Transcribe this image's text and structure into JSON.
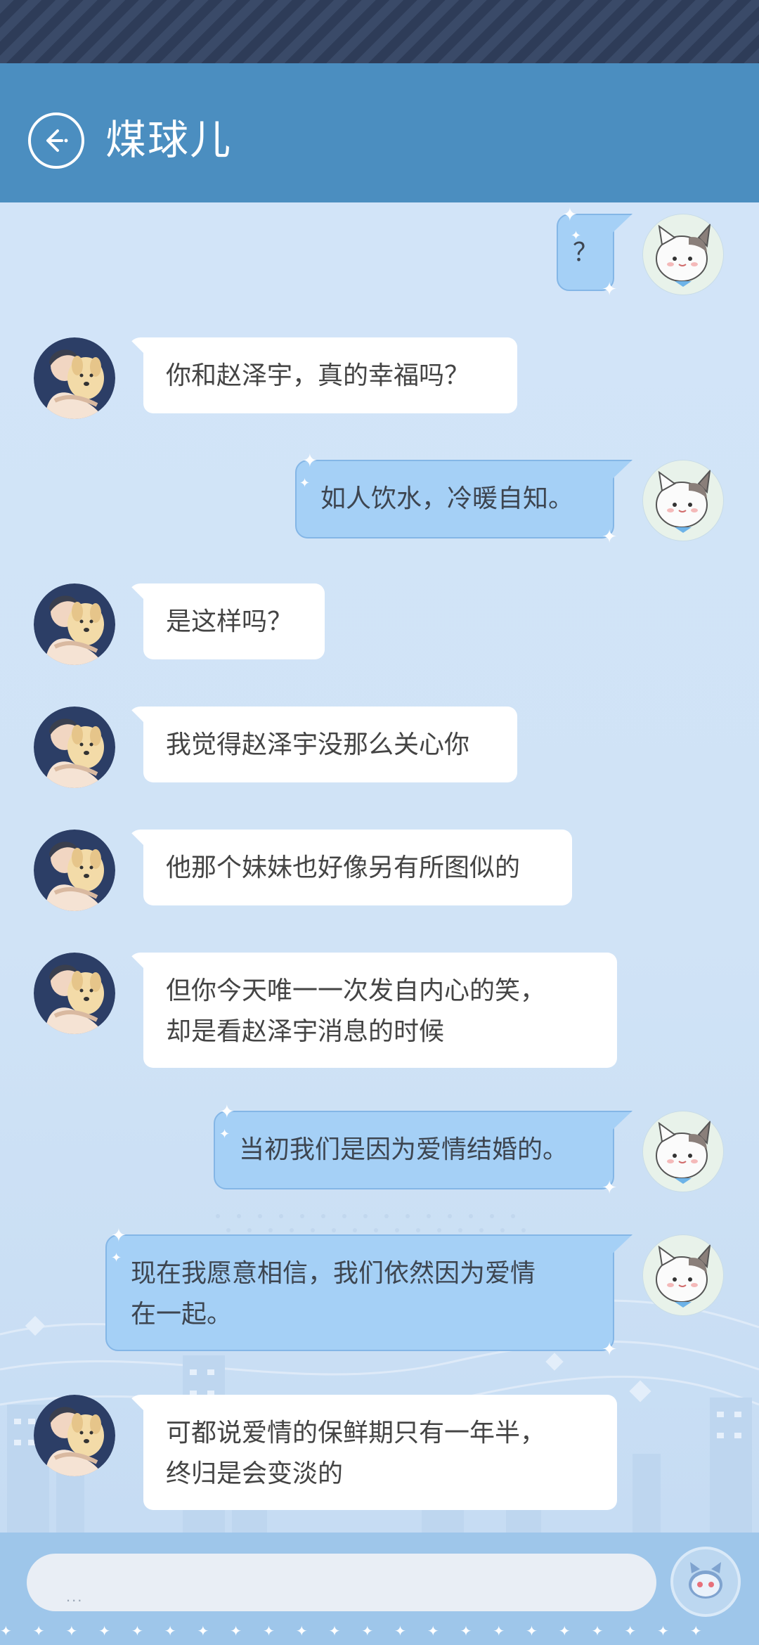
{
  "header": {
    "title": "煤球儿",
    "back_icon": "back-arrow-icon"
  },
  "messages": [
    {
      "side": "out",
      "lines": [
        "？"
      ]
    },
    {
      "side": "in",
      "lines": [
        "你和赵泽宇，真的幸福吗？"
      ]
    },
    {
      "side": "out",
      "lines": [
        "如人饮水，冷暖自知。"
      ]
    },
    {
      "side": "in",
      "lines": [
        "是这样吗？"
      ]
    },
    {
      "side": "in",
      "lines": [
        "我觉得赵泽宇没那么关心你"
      ]
    },
    {
      "side": "in",
      "lines": [
        "他那个妹妹也好像另有所图似的"
      ]
    },
    {
      "side": "in",
      "lines": [
        "但你今天唯一一次发自内心的笑，",
        "却是看赵泽宇消息的时候"
      ]
    },
    {
      "side": "out",
      "lines": [
        "当初我们是因为爱情结婚的。"
      ]
    },
    {
      "side": "out",
      "lines": [
        "现在我愿意相信，我们依然因为爱情",
        "在一起。"
      ]
    },
    {
      "side": "in",
      "lines": [
        "可都说爱情的保鲜期只有一年半，",
        "终归是会变淡的"
      ]
    }
  ],
  "input": {
    "placeholder": "..."
  },
  "colors": {
    "header": "#4b8ec0",
    "chat_bg": "#cfe2f6",
    "outgoing_bubble": "#a5d0f6",
    "incoming_bubble": "#ffffff"
  },
  "avatars": {
    "contact": "man-with-dog-avatar",
    "self": "white-cat-avatar"
  }
}
